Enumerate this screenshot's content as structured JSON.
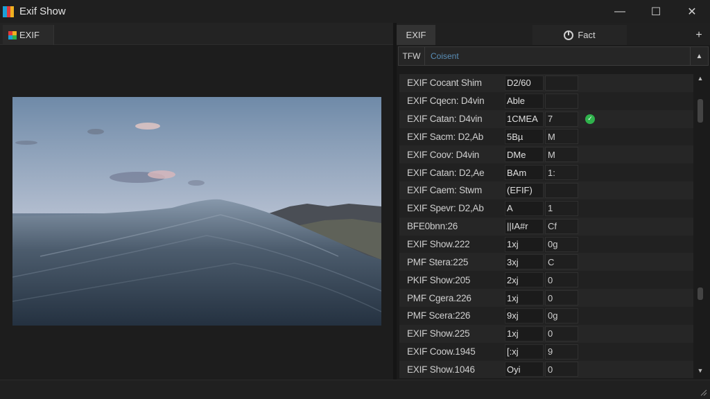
{
  "window": {
    "title": "Exif Show",
    "minimize_glyph": "—",
    "maximize_glyph": "☐",
    "close_glyph": "✕"
  },
  "left_tabs": [
    {
      "label": "EXIF"
    }
  ],
  "right_tabs": [
    {
      "label": "EXIF"
    },
    {
      "label": "Fact"
    }
  ],
  "add_tab_glyph": "+",
  "filter": {
    "label": "TFW",
    "placeholder": "Coisent",
    "dropdown_glyph": "▲"
  },
  "rows": [
    {
      "label": "EXIF Cocant Shim",
      "value1": "D2/60",
      "value2": ""
    },
    {
      "label": "EXIF Cqecn: D4vin",
      "value1": "Able",
      "value2": ""
    },
    {
      "label": "EXIF Catan: D4vin",
      "value1": "1CMEA",
      "value2": "7",
      "verified": true
    },
    {
      "label": "EXIF Sacm: D2,Ab",
      "value1": "5Bµ",
      "value2": "M"
    },
    {
      "label": "EXIF Coov: D4vin",
      "value1": "DMe",
      "value2": "M"
    },
    {
      "label": "EXIF Catan: D2,Ae",
      "value1": "BAm",
      "value2": "1:"
    },
    {
      "label": "EXIF Caem: Stwm",
      "value1": "(EFIF)",
      "value2": ""
    },
    {
      "label": "EXIF Spevr: D2,Ab",
      "value1": "A",
      "value2": "1"
    },
    {
      "label": "BFE0bnn:26",
      "value1": "||IA#r",
      "value2": "Cf"
    },
    {
      "label": "EXIF Show.222",
      "value1": "1xj",
      "value2": "0g"
    },
    {
      "label": "PMF Stera:225",
      "value1": "3xj",
      "value2": "C"
    },
    {
      "label": "PKIF Show:205",
      "value1": "2xj",
      "value2": "0"
    },
    {
      "label": "PMF Cgera.226",
      "value1": "1xj",
      "value2": "0"
    },
    {
      "label": "PMF Scera:226",
      "value1": "9xj",
      "value2": "0g"
    },
    {
      "label": "EXIF Show.225",
      "value1": "1xj",
      "value2": "0"
    },
    {
      "label": "EXIF Coow.1945",
      "value1": "[:xj",
      "value2": "9"
    },
    {
      "label": "EXIF Show.1046",
      "value1": "Oyi",
      "value2": "0"
    }
  ],
  "scrollbar": {
    "up_glyph": "▲",
    "down_glyph": "▼"
  },
  "colors": {
    "verified": "#2fb24c",
    "placeholder": "#5a8fb8"
  }
}
